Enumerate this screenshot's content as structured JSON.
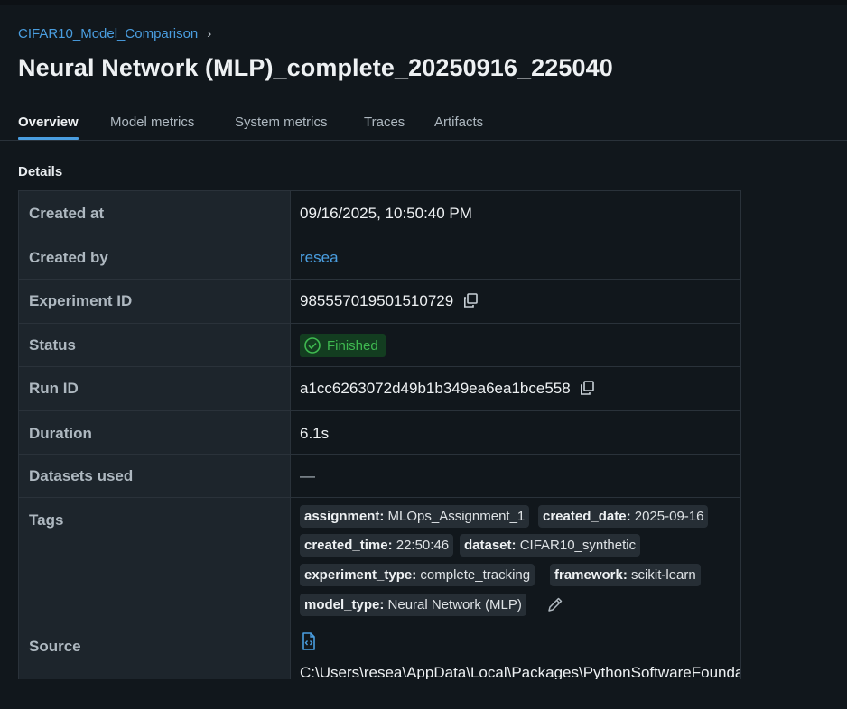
{
  "breadcrumb": {
    "experiment": "CIFAR10_Model_Comparison",
    "separator": "›"
  },
  "title": "Neural Network (MLP)_complete_20250916_225040",
  "tabs": [
    {
      "label": "Overview",
      "active": true
    },
    {
      "label": "Model metrics",
      "active": false
    },
    {
      "label": "System metrics",
      "active": false
    },
    {
      "label": "Traces",
      "active": false
    },
    {
      "label": "Artifacts",
      "active": false
    }
  ],
  "details": {
    "heading": "Details",
    "created_at": {
      "label": "Created at",
      "value": "09/16/2025, 10:50:40 PM"
    },
    "created_by": {
      "label": "Created by",
      "value": "resea"
    },
    "experiment_id": {
      "label": "Experiment ID",
      "value": "985557019501510729"
    },
    "status": {
      "label": "Status",
      "value": "Finished",
      "color": "#3fb950"
    },
    "run_id": {
      "label": "Run ID",
      "value": "a1cc6263072d49b1b349ea6ea1bce558"
    },
    "duration": {
      "label": "Duration",
      "value": "6.1s"
    },
    "datasets": {
      "label": "Datasets used",
      "value": "—"
    },
    "tags": {
      "label": "Tags",
      "items": [
        {
          "key": "assignment",
          "value": "MLOps_Assignment_1"
        },
        {
          "key": "created_date",
          "value": "2025-09-16"
        },
        {
          "key": "created_time",
          "value": "22:50:46"
        },
        {
          "key": "dataset",
          "value": "CIFAR10_synthetic"
        },
        {
          "key": "experiment_type",
          "value": "complete_tracking"
        },
        {
          "key": "framework",
          "value": "scikit-learn"
        },
        {
          "key": "model_type",
          "value": "Neural Network (MLP)"
        }
      ]
    },
    "source": {
      "label": "Source",
      "value": "C:\\Users\\resea\\AppData\\Local\\Packages\\PythonSoftwareFoundation"
    }
  },
  "colors": {
    "accent": "#4a9ee0",
    "background": "#11171c",
    "label_bg": "#1d252c",
    "tag_bg": "#262e35",
    "success": "#3fb950"
  },
  "icons": {
    "copy": "copy-icon",
    "status": "check-circle-icon",
    "edit": "pencil-icon",
    "source": "code-file-icon"
  }
}
